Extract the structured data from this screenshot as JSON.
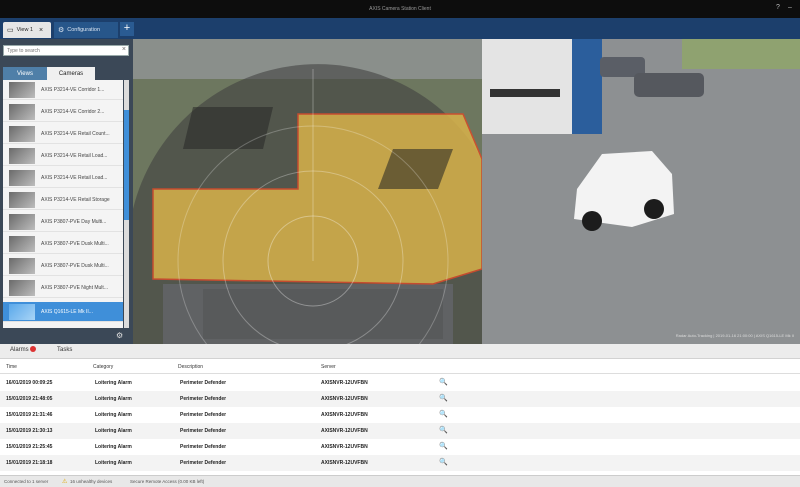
{
  "window": {
    "title": "AXIS Camera Station Client"
  },
  "tabs": {
    "view": "View 1",
    "config": "Configuration",
    "add": "+"
  },
  "sidebar": {
    "search_placeholder": "Type to search",
    "tab_views": "Views",
    "tab_cameras": "Cameras",
    "cameras": [
      "AXIS P3214-VE Corridor 1...",
      "AXIS P3214-VE Corridor 2...",
      "AXIS P3214-VE Retail Count...",
      "AXIS P3214-VE Retail Load...",
      "AXIS P3214-VE Retail Load...",
      "AXIS P3214-VE Retail Storage",
      "AXIS P3807-PVE Day Multi...",
      "AXIS P3807-PVE Dusk Multi...",
      "AXIS P3807-PVE Dusk Multi...",
      "AXIS P3807-PVE Night Mult...",
      "AXIS Q1615-LE Mk II..."
    ]
  },
  "overlay": {
    "right_caption": "Radar Auto-Tracking | 2019-01-16 21:00:00 | AXIS Q1615-LE Mk II"
  },
  "bottom": {
    "tab_alarms": "Alarms",
    "tab_tasks": "Tasks",
    "columns": [
      "Time",
      "Category",
      "Description",
      "Server"
    ],
    "rows": [
      {
        "time": "16/01/2019 00:09:25",
        "category": "Loitering Alarm",
        "description": "Perimeter Defender",
        "server": "AXISNVR-12UVFBN"
      },
      {
        "time": "15/01/2019 21:48:05",
        "category": "Loitering Alarm",
        "description": "Perimeter Defender",
        "server": "AXISNVR-12UVFBN"
      },
      {
        "time": "15/01/2019 21:31:46",
        "category": "Loitering Alarm",
        "description": "Perimeter Defender",
        "server": "AXISNVR-12UVFBN"
      },
      {
        "time": "15/01/2019 21:30:13",
        "category": "Loitering Alarm",
        "description": "Perimeter Defender",
        "server": "AXISNVR-12UVFBN"
      },
      {
        "time": "15/01/2019 21:25:45",
        "category": "Loitering Alarm",
        "description": "Perimeter Defender",
        "server": "AXISNVR-12UVFBN"
      },
      {
        "time": "15/01/2019 21:18:18",
        "category": "Loitering Alarm",
        "description": "Perimeter Defender",
        "server": "AXISNVR-12UVFBN"
      }
    ]
  },
  "statusbar": {
    "connected": "Connected to 1 server",
    "warning": "16 unhealthy devices",
    "secure": "Secure Remote Access (0.00 KB left)"
  }
}
